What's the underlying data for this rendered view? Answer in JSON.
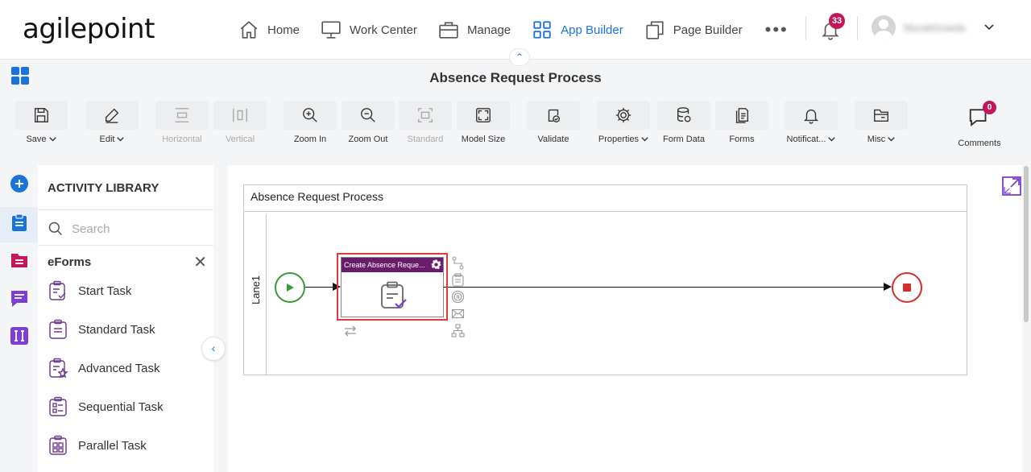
{
  "header": {
    "logo": "agilepoint",
    "nav": [
      {
        "label": "Home",
        "icon": "home-icon"
      },
      {
        "label": "Work Center",
        "icon": "monitor-icon"
      },
      {
        "label": "Manage",
        "icon": "briefcase-icon"
      },
      {
        "label": "App Builder",
        "icon": "grid-icon",
        "active": true
      },
      {
        "label": "Page Builder",
        "icon": "pages-icon"
      }
    ],
    "more": "•••",
    "notifications_count": "33",
    "username": "MuraliGowda"
  },
  "title_bar": {
    "collapse_glyph": "⌃",
    "title": "Absence Request Process"
  },
  "toolbar": {
    "items": [
      {
        "label": "Save",
        "dropdown": true,
        "icon": "save-icon",
        "disabled": false
      },
      {
        "label": "Edit",
        "dropdown": true,
        "icon": "pencil-icon",
        "disabled": false
      },
      {
        "label": "Horizontal",
        "dropdown": false,
        "icon": "align-horizontal-icon",
        "disabled": true
      },
      {
        "label": "Vertical",
        "dropdown": false,
        "icon": "align-vertical-icon",
        "disabled": true
      },
      {
        "label": "Zoom In",
        "dropdown": false,
        "icon": "zoom-in-icon",
        "disabled": false
      },
      {
        "label": "Zoom Out",
        "dropdown": false,
        "icon": "zoom-out-icon",
        "disabled": false
      },
      {
        "label": "Standard",
        "dropdown": false,
        "icon": "standard-size-icon",
        "disabled": true
      },
      {
        "label": "Model Size",
        "dropdown": false,
        "icon": "model-size-icon",
        "disabled": false
      },
      {
        "label": "Validate",
        "dropdown": false,
        "icon": "validate-icon",
        "disabled": false
      },
      {
        "label": "Properties",
        "dropdown": true,
        "icon": "gear-icon",
        "disabled": false
      },
      {
        "label": "Form Data",
        "dropdown": false,
        "icon": "database-icon",
        "disabled": false
      },
      {
        "label": "Forms",
        "dropdown": false,
        "icon": "forms-icon",
        "disabled": false
      },
      {
        "label": "Notificat...",
        "dropdown": true,
        "icon": "bell-icon",
        "disabled": false
      },
      {
        "label": "Misc",
        "dropdown": true,
        "icon": "folder-icon",
        "disabled": false
      }
    ],
    "comments": {
      "label": "Comments",
      "count": "0"
    }
  },
  "library": {
    "title": "ACTIVITY LIBRARY",
    "search_placeholder": "Search",
    "category": "eForms",
    "close_glyph": "✕",
    "collapse_glyph": "‹",
    "tasks": [
      {
        "label": "Start Task",
        "icon": "start-task-icon"
      },
      {
        "label": "Standard Task",
        "icon": "standard-task-icon"
      },
      {
        "label": "Advanced Task",
        "icon": "advanced-task-icon"
      },
      {
        "label": "Sequential Task",
        "icon": "sequential-task-icon"
      },
      {
        "label": "Parallel Task",
        "icon": "parallel-task-icon"
      }
    ]
  },
  "process": {
    "pool_title": "Absence Request Process",
    "lane": "Lane1",
    "activity_title": "Create Absence Reque..."
  },
  "colors": {
    "accent": "#1a73d9",
    "badge": "#c2185b",
    "activity_header": "#6a1b6a",
    "start_event": "#3a9a3a",
    "end_event": "#d32f2f",
    "selection": "#e53935",
    "library_icon": "#6e3a8e"
  }
}
